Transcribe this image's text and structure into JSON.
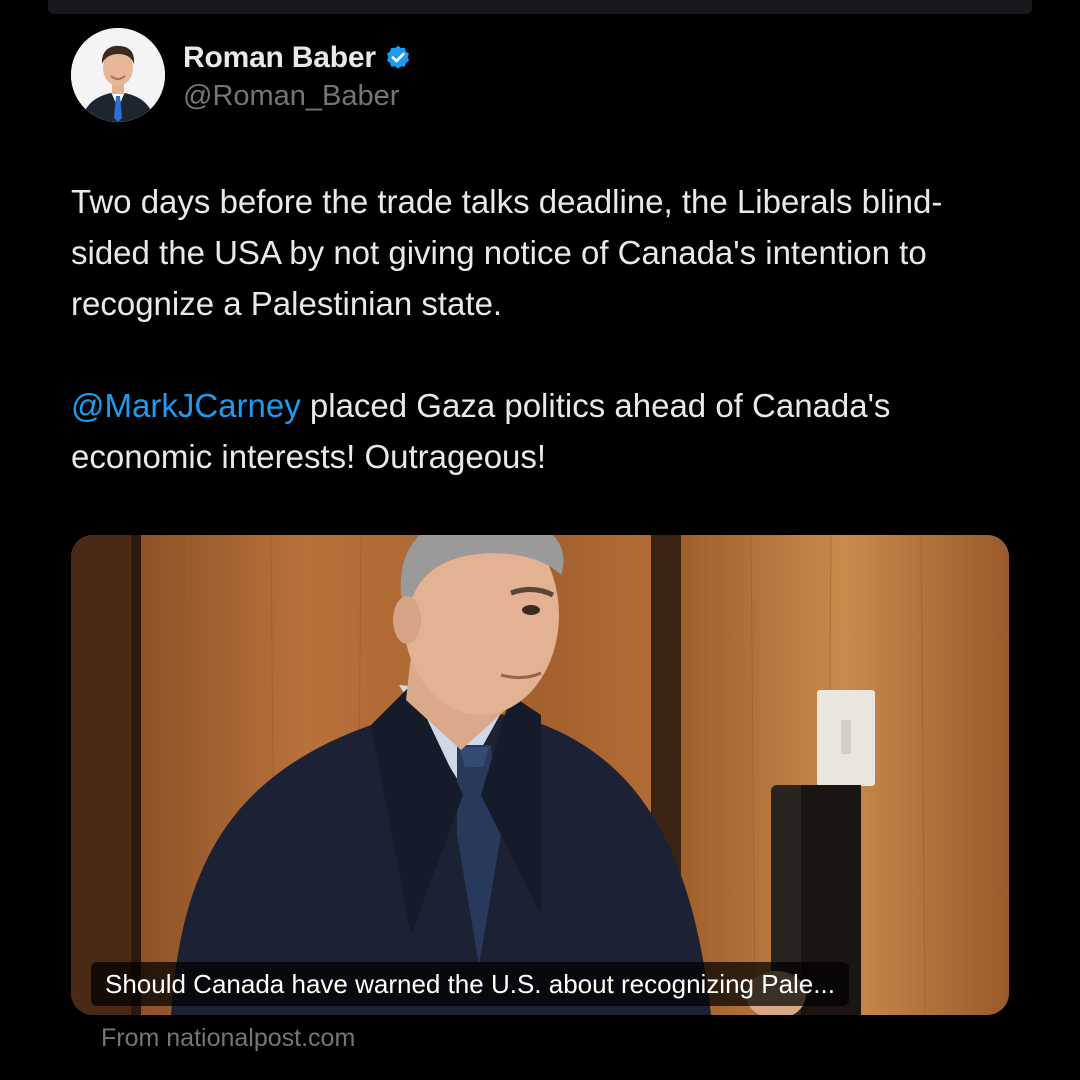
{
  "author": {
    "display_name": "Roman Baber",
    "handle": "@Roman_Baber",
    "verified": true,
    "verified_icon": "verified-badge-icon",
    "verified_color": "#1d9bf0"
  },
  "tweet": {
    "paragraph1": "Two days before the trade talks deadline, the Liberals blind-sided the USA by not giving notice of Canada's intention to recognize a Palestinian state.",
    "mention": "@MarkJCarney",
    "paragraph2_rest": " placed Gaza politics ahead of Canada's economic interests! Outrageous!",
    "mention_color": "#1d9bf0"
  },
  "link_card": {
    "headline": "Should Canada have warned the U.S. about recognizing Pale...",
    "source": "From nationalpost.com"
  },
  "colors": {
    "background": "#000000",
    "text_primary": "#e7e9ea",
    "text_secondary": "#71767b"
  }
}
